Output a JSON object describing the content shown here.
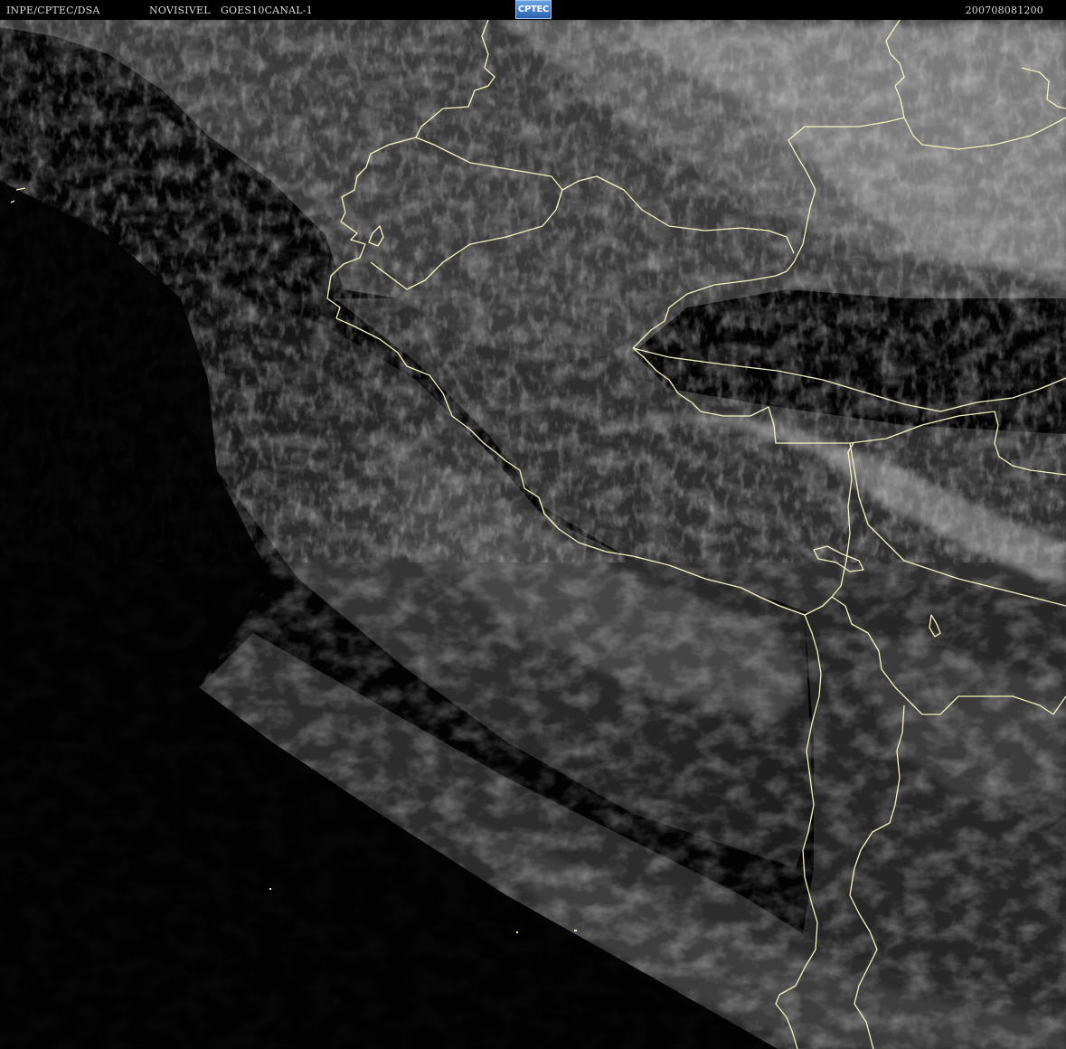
{
  "header": {
    "source": "INPE/CPTEC/DSA",
    "mode": "NOVISIVEL",
    "satellite": "GOES10CANAL-1",
    "timestamp": "200708081200"
  },
  "logo": {
    "text": "CPTEC"
  },
  "map": {
    "type": "satellite-visible-image",
    "border_color": "#f4f2c0",
    "cloud_color": "#c8c8c8",
    "ocean_color": "#000000"
  }
}
